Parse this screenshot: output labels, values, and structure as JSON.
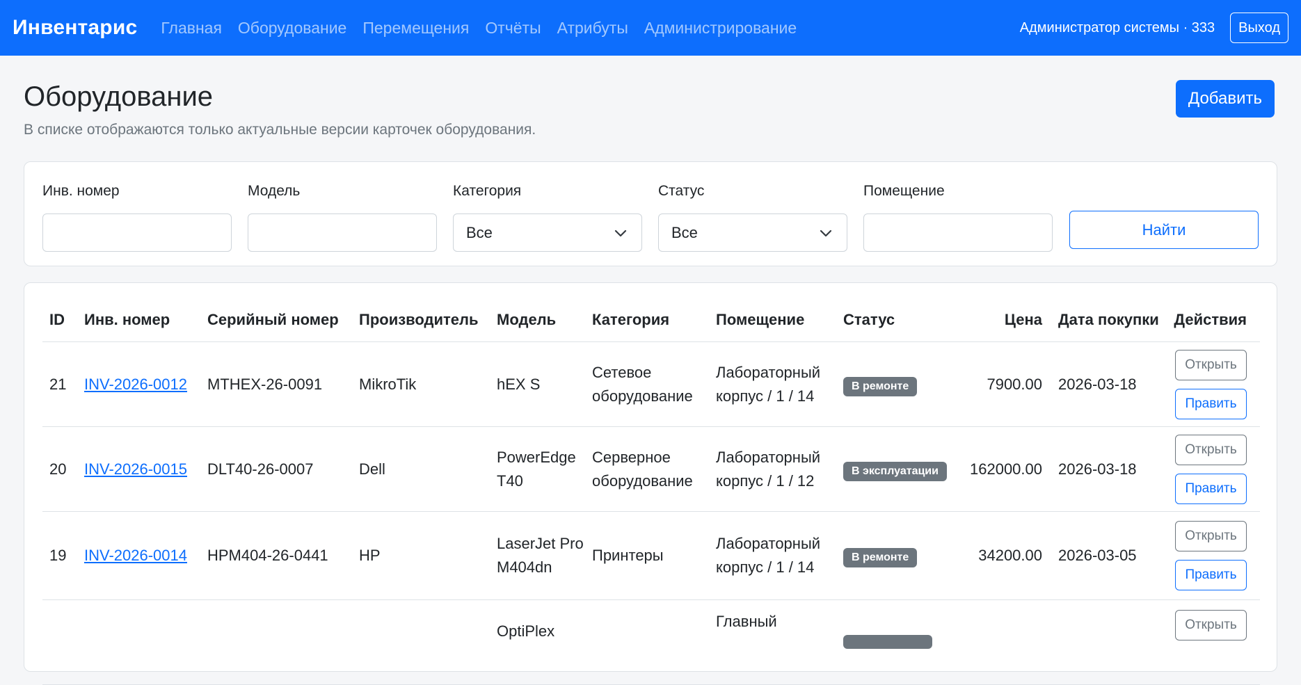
{
  "navbar": {
    "brand": "Инвентарис",
    "links": [
      "Главная",
      "Оборудование",
      "Перемещения",
      "Отчёты",
      "Атрибуты",
      "Администрирование"
    ],
    "user": "Администратор системы · 333",
    "logout": "Выход"
  },
  "header": {
    "title": "Оборудование",
    "subtitle": "В списке отображаются только актуальные версии карточек оборудования.",
    "add_button": "Добавить"
  },
  "filters": {
    "inv_label": "Инв. номер",
    "inv_value": "",
    "model_label": "Модель",
    "model_value": "",
    "category_label": "Категория",
    "category_value": "Все",
    "status_label": "Статус",
    "status_value": "Все",
    "room_label": "Помещение",
    "room_value": "",
    "find_button": "Найти"
  },
  "table": {
    "headers": [
      "ID",
      "Инв. номер",
      "Серийный номер",
      "Производитель",
      "Модель",
      "Категория",
      "Помещение",
      "Статус",
      "Цена",
      "Дата покупки",
      "Действия"
    ],
    "open_label": "Открыть",
    "edit_label": "Править",
    "rows": [
      {
        "id": "21",
        "inv": "INV-2026-0012",
        "serial": "MTHEX-26-0091",
        "maker": "MikroTik",
        "model": "hEX S",
        "category": "Сетевое оборудование",
        "room": "Лабораторный корпус / 1 / 14",
        "status": "В ремонте",
        "price": "7900.00",
        "date": "2026-03-18"
      },
      {
        "id": "20",
        "inv": "INV-2026-0015",
        "serial": "DLT40-26-0007",
        "maker": "Dell",
        "model": "PowerEdge T40",
        "category": "Серверное оборудование",
        "room": "Лабораторный корпус / 1 / 12",
        "status": "В эксплуатации",
        "price": "162000.00",
        "date": "2026-03-18"
      },
      {
        "id": "19",
        "inv": "INV-2026-0014",
        "serial": "HPM404-26-0441",
        "maker": "HP",
        "model": "LaserJet Pro M404dn",
        "category": "Принтеры",
        "room": "Лабораторный корпус / 1 / 14",
        "status": "В ремонте",
        "price": "34200.00",
        "date": "2026-03-05"
      },
      {
        "id": "",
        "inv": "",
        "serial": "",
        "maker": "",
        "model": "OptiPlex",
        "category": "",
        "room": "Главный",
        "status": "",
        "price": "",
        "date": ""
      }
    ]
  },
  "colors": {
    "primary": "#0d6efd",
    "secondary": "#6c757d"
  }
}
